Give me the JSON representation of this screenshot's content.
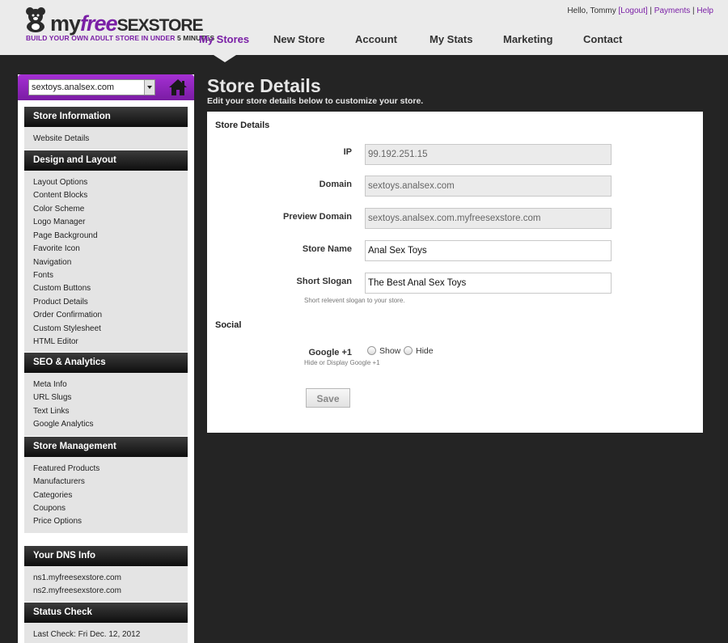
{
  "header": {
    "logo": {
      "my": "my",
      "free": "free",
      "sexstore": "SEXSTORE",
      "tagline_a": "BUILD YOUR OWN ADULT STORE IN UNDER ",
      "tagline_b": "5 MINUTES"
    },
    "greeting": "Hello, Tommy",
    "logout": "[Logout]",
    "sep1": " | ",
    "payments": "Payments",
    "sep2": " | ",
    "help": "Help",
    "nav": [
      {
        "label": "My Stores",
        "active": true
      },
      {
        "label": "New Store"
      },
      {
        "label": "Account"
      },
      {
        "label": "My Stats"
      },
      {
        "label": "Marketing"
      },
      {
        "label": "Contact"
      }
    ]
  },
  "sidebar": {
    "store_select": "sextoys.analsex.com",
    "sections": [
      {
        "title": "Store Information",
        "links": [
          "Website Details"
        ]
      },
      {
        "title": "Design and Layout",
        "links": [
          "Layout Options",
          "Content Blocks",
          "Color Scheme",
          "Logo Manager",
          "Page Background",
          "Favorite Icon",
          "Navigation",
          "Fonts",
          "Custom Buttons",
          "Product Details",
          "Order Confirmation",
          "Custom Stylesheet",
          "HTML Editor"
        ]
      },
      {
        "title": "SEO & Analytics",
        "links": [
          "Meta Info",
          "URL Slugs",
          "Text Links",
          "Google Analytics"
        ]
      },
      {
        "title": "Store Management",
        "links": [
          "Featured Products",
          "Manufacturers",
          "Categories",
          "Coupons",
          "Price Options"
        ]
      }
    ],
    "dns": {
      "title": "Your DNS Info",
      "lines": [
        "ns1.myfreesexstore.com",
        "ns2.myfreesexstore.com"
      ]
    },
    "status": {
      "title": "Status Check",
      "last_check": "Last Check: Fri Dec. 12, 2012"
    }
  },
  "main": {
    "title": "Store Details",
    "subtitle": "Edit your store details below to customize your store.",
    "panel_title": "Store Details",
    "fields": [
      {
        "label": "IP",
        "value": "99.192.251.15",
        "readonly": true
      },
      {
        "label": "Domain",
        "value": "sextoys.analsex.com",
        "readonly": true
      },
      {
        "label": "Preview Domain",
        "value": "sextoys.analsex.com.myfreesexstore.com",
        "readonly": true
      },
      {
        "label": "Store Name",
        "value": "Anal Sex Toys",
        "readonly": false
      },
      {
        "label": "Short Slogan",
        "value": "The Best Anal Sex Toys",
        "readonly": false
      }
    ],
    "slogan_hint": "Short relevent slogan to your store.",
    "social_title": "Social",
    "google_label": "Google +1",
    "google_show": "Show",
    "google_hide": "Hide",
    "google_hint": "Hide or Display Google +1",
    "save": "Save"
  },
  "colors": {
    "accent": "#7a1fa6",
    "background": "#242424",
    "header": "#ebebeb"
  }
}
